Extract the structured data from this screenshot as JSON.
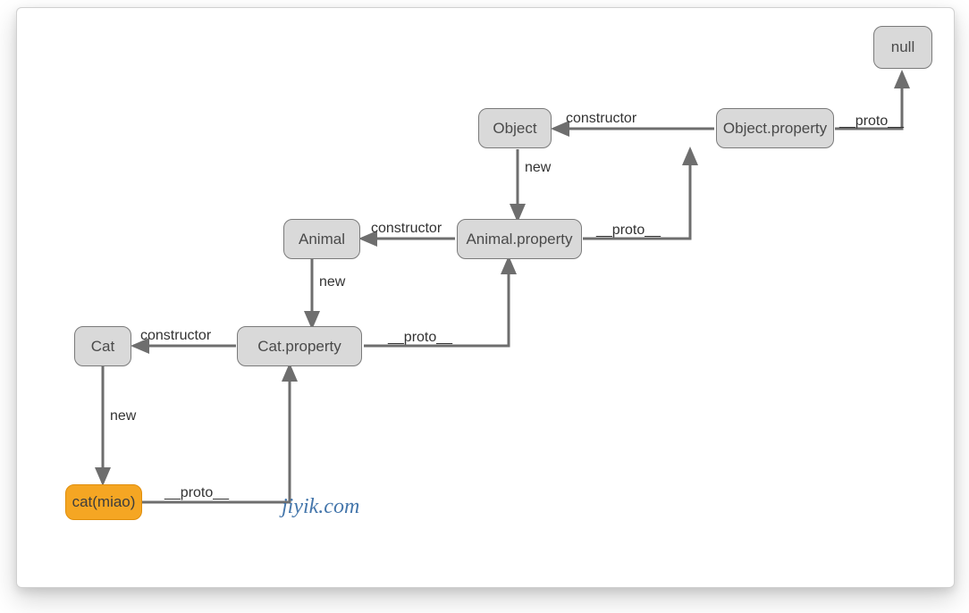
{
  "diagram": {
    "nodes": {
      "null": "null",
      "object": "Object",
      "object_property": "Object.property",
      "animal": "Animal",
      "animal_property": "Animal.property",
      "cat": "Cat",
      "cat_property": "Cat.property",
      "cat_instance": "cat(miao)"
    },
    "edges": {
      "constructor1": "constructor",
      "constructor2": "constructor",
      "constructor3": "constructor",
      "proto1": "__proto__",
      "proto2": "__proto__",
      "proto3": "__proto__",
      "proto4": "__proto__",
      "new1": "new",
      "new2": "new",
      "new3": "new"
    },
    "watermark": "jiyik.com"
  }
}
